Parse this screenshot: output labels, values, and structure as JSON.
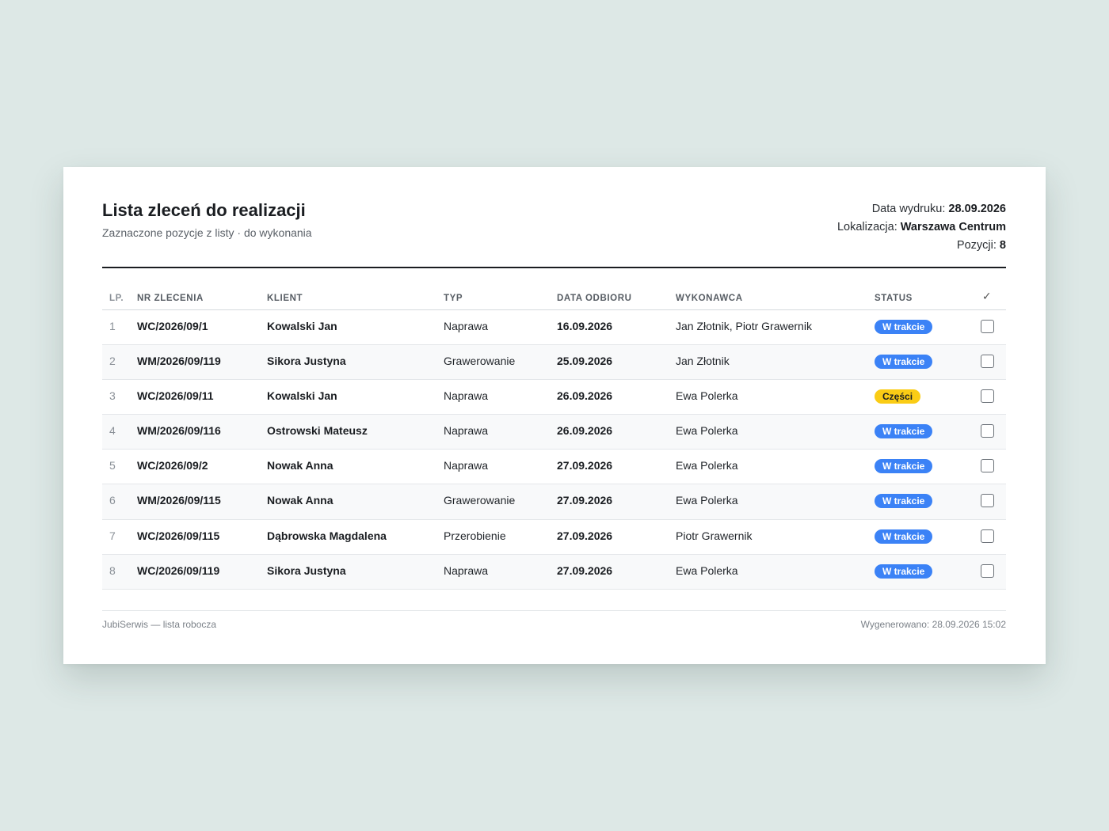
{
  "header": {
    "title": "Lista zleceń do realizacji",
    "subtitle": "Zaznaczone pozycje z listy · do wykonania",
    "print_date_label": "Data wydruku:",
    "print_date": "28.09.2026",
    "location_label": "Lokalizacja:",
    "location": "Warszawa Centrum",
    "count_label": "Pozycji:",
    "count": "8"
  },
  "table": {
    "columns": [
      "LP.",
      "NR ZLECENIA",
      "KLIENT",
      "TYP",
      "DATA ODBIORU",
      "WYKONAWCA",
      "STATUS",
      "✓"
    ],
    "rows": [
      {
        "lp": "1",
        "nr": "WC/2026/09/1",
        "klient": "Kowalski Jan",
        "typ": "Naprawa",
        "data": "16.09.2026",
        "wykonawca": "Jan Złotnik, Piotr Grawernik",
        "status": "W trakcie",
        "status_color": "#3b82f6"
      },
      {
        "lp": "2",
        "nr": "WM/2026/09/119",
        "klient": "Sikora Justyna",
        "typ": "Grawerowanie",
        "data": "25.09.2026",
        "wykonawca": "Jan Złotnik",
        "status": "W trakcie",
        "status_color": "#3b82f6"
      },
      {
        "lp": "3",
        "nr": "WC/2026/09/11",
        "klient": "Kowalski Jan",
        "typ": "Naprawa",
        "data": "26.09.2026",
        "wykonawca": "Ewa Polerka",
        "status": "Części",
        "status_color": "#facc15"
      },
      {
        "lp": "4",
        "nr": "WM/2026/09/116",
        "klient": "Ostrowski Mateusz",
        "typ": "Naprawa",
        "data": "26.09.2026",
        "wykonawca": "Ewa Polerka",
        "status": "W trakcie",
        "status_color": "#3b82f6"
      },
      {
        "lp": "5",
        "nr": "WC/2026/09/2",
        "klient": "Nowak Anna",
        "typ": "Naprawa",
        "data": "27.09.2026",
        "wykonawca": "Ewa Polerka",
        "status": "W trakcie",
        "status_color": "#3b82f6"
      },
      {
        "lp": "6",
        "nr": "WM/2026/09/115",
        "klient": "Nowak Anna",
        "typ": "Grawerowanie",
        "data": "27.09.2026",
        "wykonawca": "Ewa Polerka",
        "status": "W trakcie",
        "status_color": "#3b82f6"
      },
      {
        "lp": "7",
        "nr": "WC/2026/09/115",
        "klient": "Dąbrowska Magdalena",
        "typ": "Przerobienie",
        "data": "27.09.2026",
        "wykonawca": "Piotr Grawernik",
        "status": "W trakcie",
        "status_color": "#3b82f6"
      },
      {
        "lp": "8",
        "nr": "WC/2026/09/119",
        "klient": "Sikora Justyna",
        "typ": "Naprawa",
        "data": "27.09.2026",
        "wykonawca": "Ewa Polerka",
        "status": "W trakcie",
        "status_color": "#3b82f6"
      }
    ]
  },
  "footer": {
    "left": "JubiSerwis — lista robocza",
    "right": "Wygenerowano: 28.09.2026 15:02"
  }
}
